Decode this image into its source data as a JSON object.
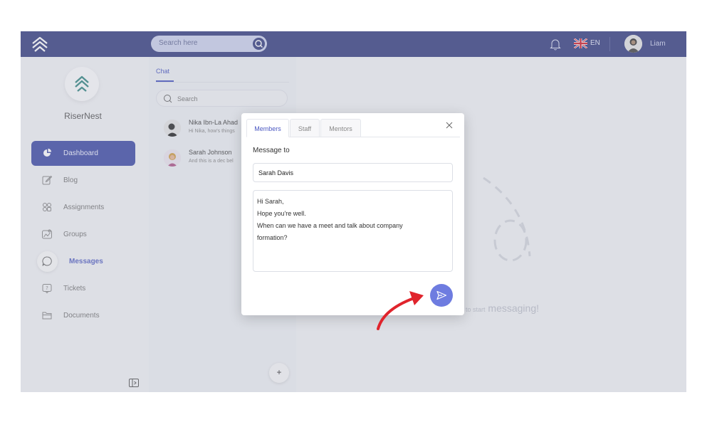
{
  "topbar": {
    "search_placeholder": "Search here",
    "language": "EN",
    "user_name": "Liam"
  },
  "sidebar": {
    "brand": "RiserNest",
    "items": [
      {
        "label": "Dashboard",
        "icon": "pie-chart-icon",
        "state": "active"
      },
      {
        "label": "Blog",
        "icon": "edit-icon",
        "state": "normal"
      },
      {
        "label": "Assignments",
        "icon": "assignments-icon",
        "state": "normal"
      },
      {
        "label": "Groups",
        "icon": "groups-icon",
        "state": "normal"
      },
      {
        "label": "Messages",
        "icon": "chat-bubble-icon",
        "state": "selected"
      },
      {
        "label": "Tickets",
        "icon": "ticket-icon",
        "state": "normal"
      },
      {
        "label": "Documents",
        "icon": "folder-icon",
        "state": "normal"
      }
    ]
  },
  "chat_panel": {
    "tab": "Chat",
    "search_placeholder": "Search",
    "conversations": [
      {
        "name": "Nika Ibn-La Ahad",
        "preview": "Hi Nika, how's things"
      },
      {
        "name": "Sarah Johnson",
        "preview": "And this is a dec bel"
      }
    ],
    "add_label": "+"
  },
  "main": {
    "empty_prefix": "to start",
    "empty_text": "messaging!"
  },
  "modal": {
    "tabs": [
      "Members",
      "Staff",
      "Mentors"
    ],
    "active_tab": "Members",
    "label": "Message to",
    "recipient": "Sarah Davis",
    "message_lines": [
      "Hi Sarah,",
      "Hope you're well.",
      "When can we have a meet and talk about company",
      "formation?"
    ]
  },
  "colors": {
    "topbar": "#3c4585",
    "accent": "#4550a8",
    "send_button": "#6e7ce0",
    "annotation_arrow": "#e0242c"
  }
}
